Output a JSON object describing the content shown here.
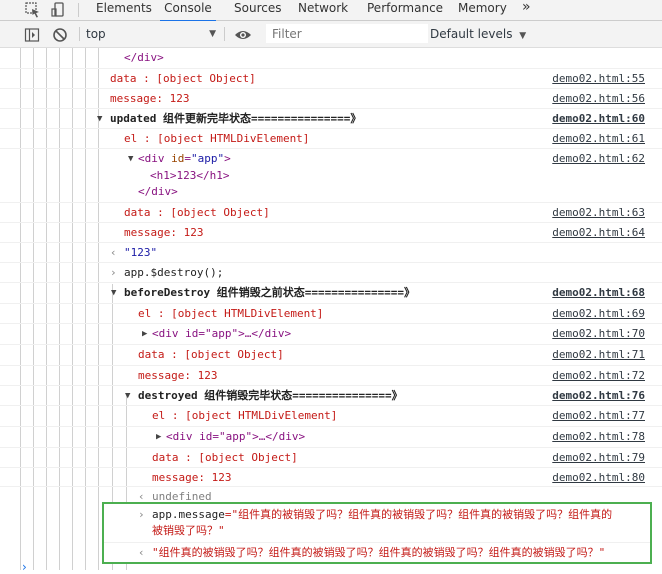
{
  "tabs": {
    "elements": "Elements",
    "console": "Console",
    "sources": "Sources",
    "network": "Network",
    "performance": "Performance",
    "memory": "Memory",
    "more": "»"
  },
  "toolbar": {
    "context": "top",
    "filter_placeholder": "Filter",
    "levels": "Default levels"
  },
  "console": {
    "r1": {
      "text": "</div>"
    },
    "r2": {
      "text": "data   : [object Object]",
      "link": "demo02.html:55"
    },
    "r3": {
      "text": "message: 123",
      "link": "demo02.html:56"
    },
    "r4": {
      "text": "updated 组件更新完毕状态===============》",
      "link": "demo02.html:60"
    },
    "r5": {
      "text": "el     : [object HTMLDivElement]",
      "link": "demo02.html:61"
    },
    "r6": {
      "text_open": "<div ",
      "attr": "id",
      "eq": "=",
      "val": "\"app\"",
      "text_close": ">",
      "link": "demo02.html:62"
    },
    "r7": {
      "text": "<h1>123</h1>"
    },
    "r8": {
      "text": "</div>"
    },
    "r9": {
      "text": "data   : [object Object]",
      "link": "demo02.html:63"
    },
    "r10": {
      "text": "message: 123",
      "link": "demo02.html:64"
    },
    "r11": {
      "text": "\"123\""
    },
    "r12": {
      "text": "app.$destroy();"
    },
    "r13": {
      "text": "beforeDestroy 组件销毁之前状态===============》",
      "link": "demo02.html:68"
    },
    "r14": {
      "text": "el     : [object HTMLDivElement]",
      "link": "demo02.html:69"
    },
    "r15": {
      "text": "<div id=\"app\">…</div>",
      "link": "demo02.html:70"
    },
    "r16": {
      "text": "data   : [object Object]",
      "link": "demo02.html:71"
    },
    "r17": {
      "text": "message: 123",
      "link": "demo02.html:72"
    },
    "r18": {
      "text": "destroyed 组件销毁完毕状态===============》",
      "link": "demo02.html:76"
    },
    "r19": {
      "text": "el     : [object HTMLDivElement]",
      "link": "demo02.html:77"
    },
    "r20": {
      "text": "<div id=\"app\">…</div>",
      "link": "demo02.html:78"
    },
    "r21": {
      "text": "data   : [object Object]",
      "link": "demo02.html:79"
    },
    "r22": {
      "text": "message: 123",
      "link": "demo02.html:80"
    },
    "r23": {
      "text": "undefined"
    },
    "r24": {
      "cmd": "app.message",
      "str1": "=\"组件真的被销毁了吗？组件真的被销毁了吗？组件真的被销毁了吗？组件真的",
      "str2": "被销毁了吗？\""
    },
    "r25": {
      "text": "\"组件真的被销毁了吗？组件真的被销毁了吗？组件真的被销毁了吗？组件真的被销毁了吗？\""
    }
  },
  "colors": {
    "accent": "#1a73e8",
    "error_red": "#c41a16",
    "highlight_box": "#4caf50"
  }
}
